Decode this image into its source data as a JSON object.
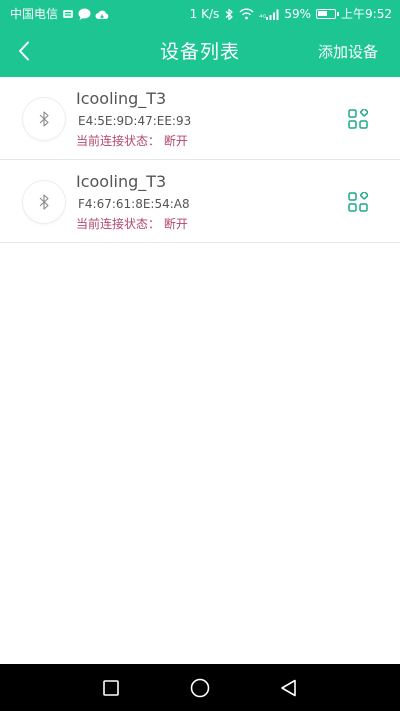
{
  "status_bar": {
    "carrier": "中国电信",
    "net_speed": "1 K/s",
    "signal_type": "⁴ᴳ",
    "battery_percent": "59%",
    "battery_level": 0.59,
    "time": "上午9:52",
    "icons": [
      "sim-icon",
      "chat-icon",
      "cloud-icon",
      "bluetooth-icon",
      "wifi-icon",
      "signal-icon",
      "battery-icon"
    ]
  },
  "toolbar": {
    "title": "设备列表",
    "add_label": "添加设备",
    "back_icon": "back-arrow-icon"
  },
  "devices": [
    {
      "name": "Icooling_T3",
      "mac": "E4:5E:9D:47:EE:93",
      "status": "当前连接状态： 断开",
      "icon": "bluetooth-icon",
      "action_icon": "grid-icon"
    },
    {
      "name": "Icooling_T3",
      "mac": "F4:67:61:8E:54:A8",
      "status": "当前连接状态： 断开",
      "icon": "bluetooth-icon",
      "action_icon": "grid-icon"
    }
  ],
  "nav_bar": {
    "buttons": [
      "recent-apps-icon",
      "home-icon",
      "back-icon"
    ]
  },
  "colors": {
    "accent": "#1dc592",
    "status_text": "#b5486a",
    "name_text": "#555555",
    "nav_bg": "#000000"
  }
}
